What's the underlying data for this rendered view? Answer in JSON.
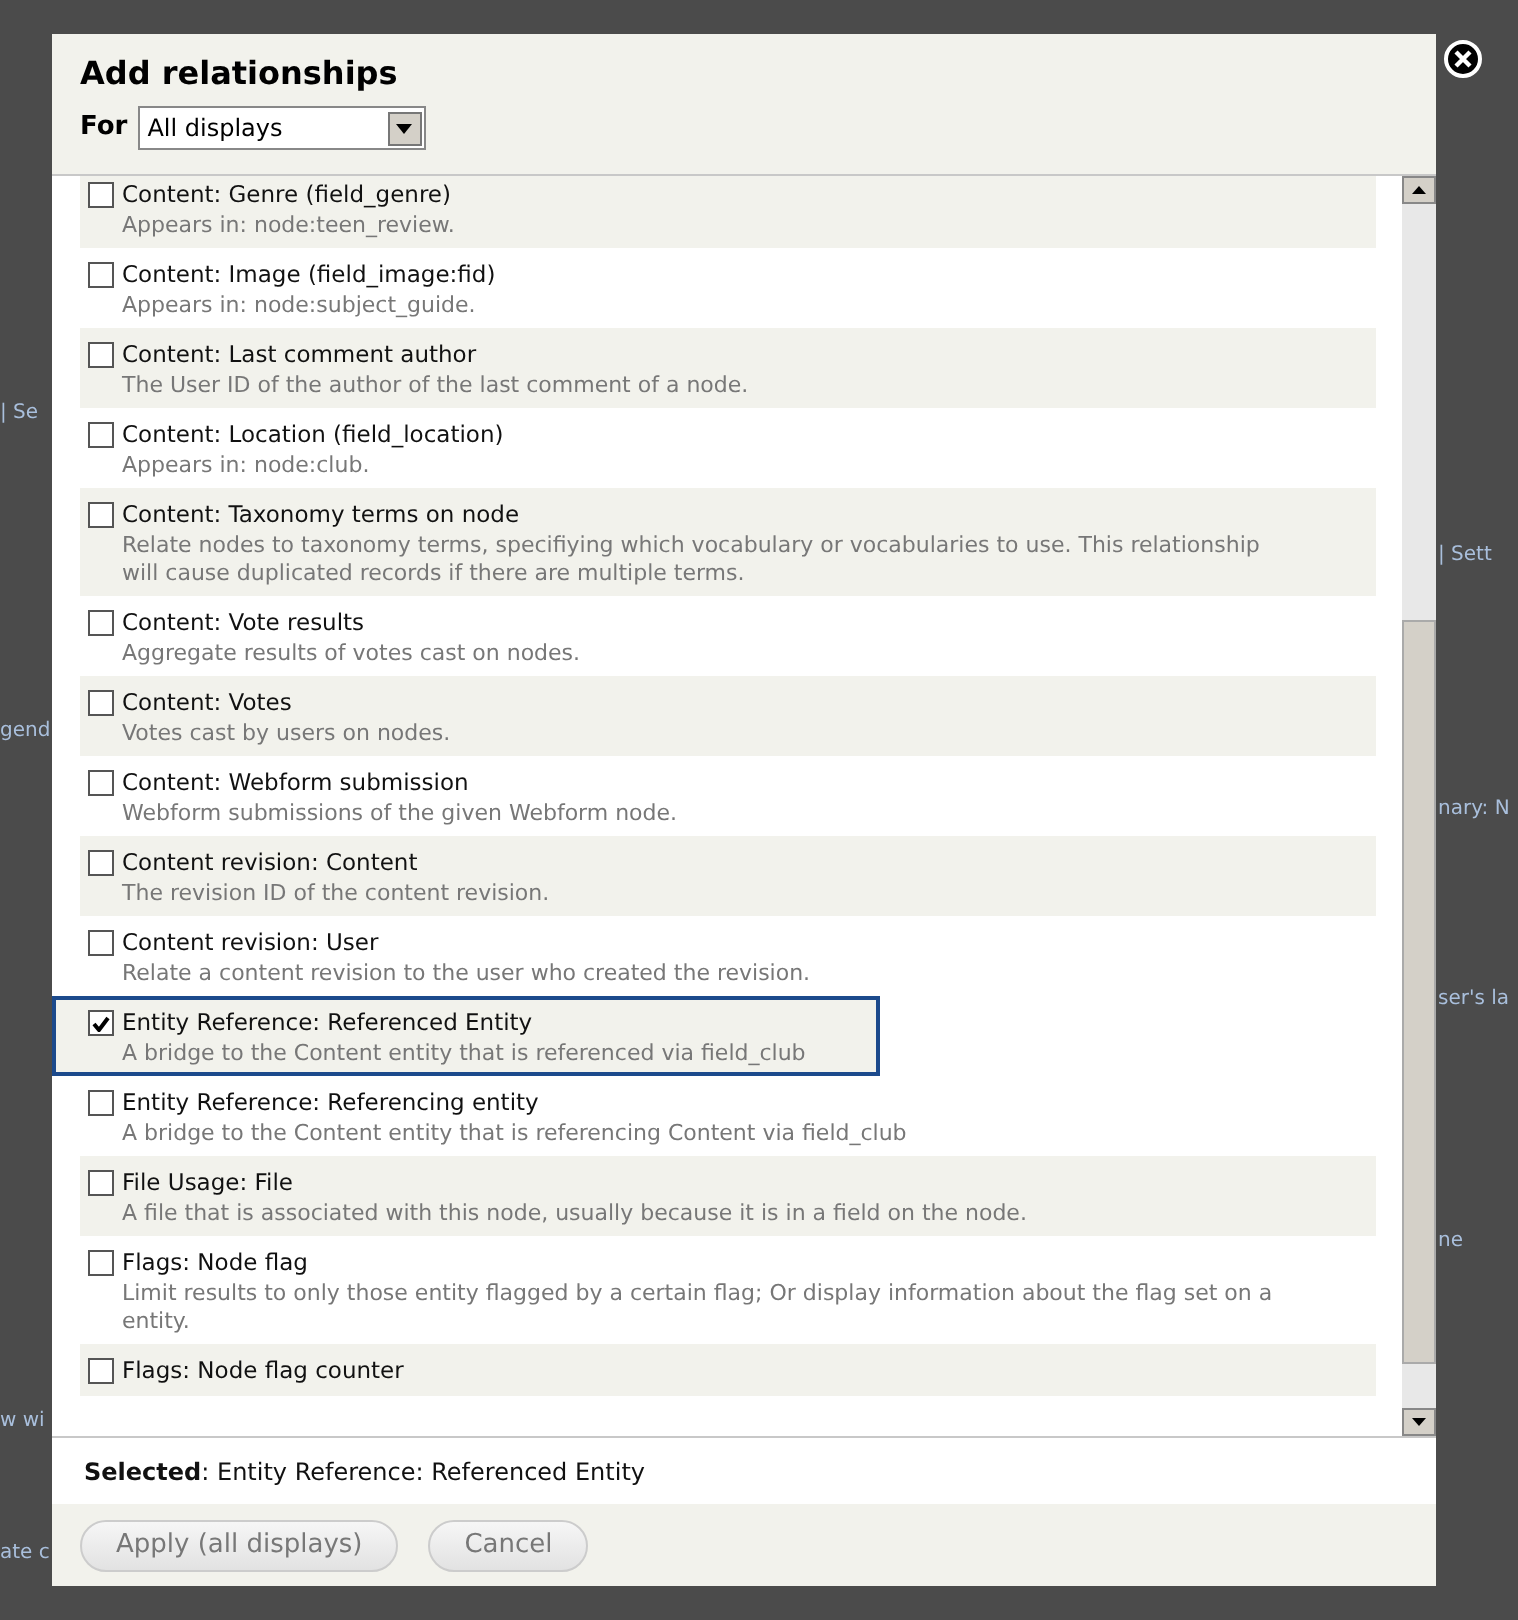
{
  "background_left": [
    "| Se",
    "gend",
    "w wi",
    "ate c"
  ],
  "background_right": [
    "| Sett",
    "nary: N",
    "ser's la",
    "ne"
  ],
  "dialog": {
    "title": "Add relationships",
    "for_label": "For",
    "for_select": {
      "value": "All displays"
    },
    "items": [
      {
        "label": "Content: Genre (field_genre)",
        "description": "Appears in: node:teen_review.",
        "checked": false,
        "selected": false
      },
      {
        "label": "Content: Image (field_image:fid)",
        "description": "Appears in: node:subject_guide.",
        "checked": false,
        "selected": false
      },
      {
        "label": "Content: Last comment author",
        "description": "The User ID of the author of the last comment of a node.",
        "checked": false,
        "selected": false
      },
      {
        "label": "Content: Location (field_location)",
        "description": "Appears in: node:club.",
        "checked": false,
        "selected": false
      },
      {
        "label": "Content: Taxonomy terms on node",
        "description": "Relate nodes to taxonomy terms, specifiying which vocabulary or vocabularies to use. This relationship will cause duplicated records if there are multiple terms.",
        "checked": false,
        "selected": false
      },
      {
        "label": "Content: Vote results",
        "description": "Aggregate results of votes cast on nodes.",
        "checked": false,
        "selected": false
      },
      {
        "label": "Content: Votes",
        "description": "Votes cast by users on nodes.",
        "checked": false,
        "selected": false
      },
      {
        "label": "Content: Webform submission",
        "description": "Webform submissions of the given Webform node.",
        "checked": false,
        "selected": false
      },
      {
        "label": "Content revision: Content",
        "description": "The revision ID of the content revision.",
        "checked": false,
        "selected": false
      },
      {
        "label": "Content revision: User",
        "description": "Relate a content revision to the user who created the revision.",
        "checked": false,
        "selected": false
      },
      {
        "label": "Entity Reference: Referenced Entity",
        "description": "A bridge to the Content entity that is referenced via field_club",
        "checked": true,
        "selected": true
      },
      {
        "label": "Entity Reference: Referencing entity",
        "description": "A bridge to the Content entity that is referencing Content via field_club",
        "checked": false,
        "selected": false
      },
      {
        "label": "File Usage: File",
        "description": "A file that is associated with this node, usually because it is in a field on the node.",
        "checked": false,
        "selected": false
      },
      {
        "label": "Flags: Node flag",
        "description": "Limit results to only those entity flagged by a certain flag; Or display information about the flag set on a entity.",
        "checked": false,
        "selected": false
      },
      {
        "label": "Flags: Node flag counter",
        "checked": false,
        "selected": false
      }
    ],
    "selected_summary": "**Selected**: Entity Reference: Referenced Entity",
    "buttons": [
      "Apply (all displays)",
      "Cancel"
    ]
  }
}
